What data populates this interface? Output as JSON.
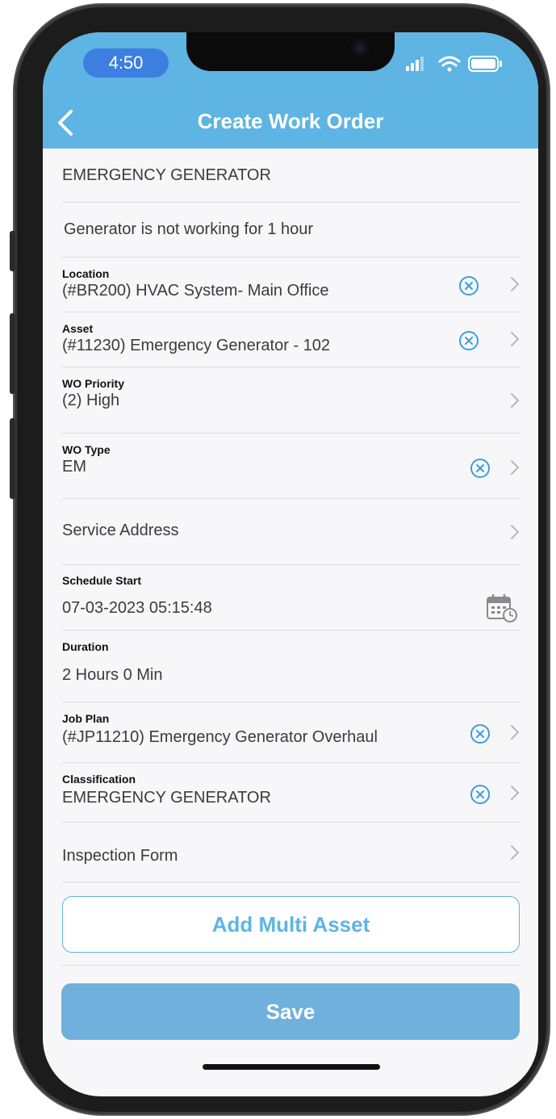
{
  "status_bar": {
    "time": "4:50"
  },
  "header": {
    "title": "Create Work Order"
  },
  "form": {
    "title_value": "EMERGENCY GENERATOR",
    "description_value": "Generator is not working for 1 hour",
    "location": {
      "label": "Location",
      "value": "(#BR200) HVAC System- Main Office"
    },
    "asset": {
      "label": "Asset",
      "value": "(#11230) Emergency Generator - 102"
    },
    "wo_priority": {
      "label": "WO Priority",
      "value": "(2) High"
    },
    "wo_type": {
      "label": "WO Type",
      "value": "EM"
    },
    "service_address": {
      "value": "Service Address"
    },
    "schedule_start": {
      "label": "Schedule Start",
      "value": "07-03-2023 05:15:48"
    },
    "duration": {
      "label": "Duration",
      "value": "2 Hours 0 Min"
    },
    "job_plan": {
      "label": "Job Plan",
      "value": "(#JP11210) Emergency Generator Overhaul"
    },
    "classification": {
      "label": "Classification",
      "value": "EMERGENCY GENERATOR"
    },
    "inspection_form": {
      "value": "Inspection Form"
    }
  },
  "buttons": {
    "add_multi_asset": "Add Multi Asset",
    "save": "Save"
  },
  "colors": {
    "header": "#5eb4e3",
    "accent": "#5eb4e3",
    "save_button": "#6fb0dc",
    "time_pill": "#3d7fe0"
  },
  "icons": [
    "back-arrow-icon",
    "clear-circle-x-icon",
    "chevron-right-icon",
    "calendar-clock-icon",
    "signal-icon",
    "wifi-icon",
    "battery-icon"
  ]
}
